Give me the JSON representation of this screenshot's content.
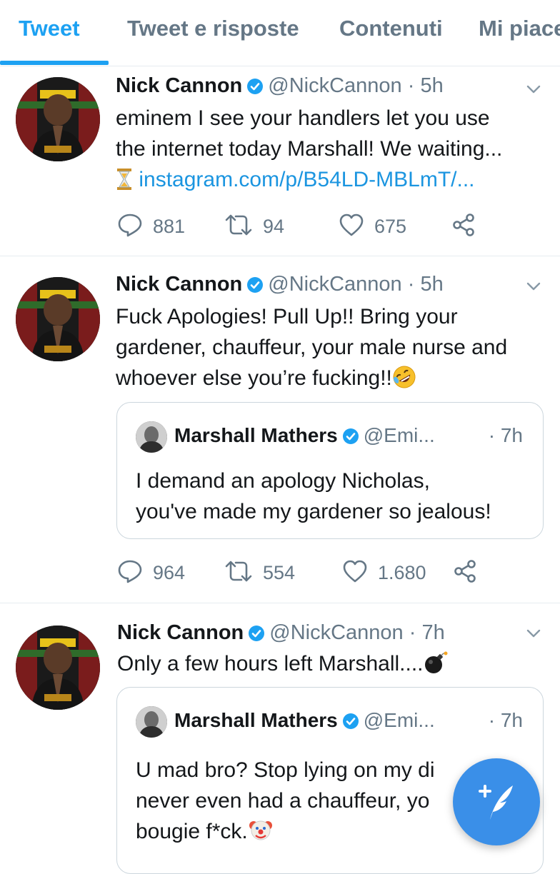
{
  "tabs": [
    {
      "label": "Tweet",
      "active": true
    },
    {
      "label": "Tweet e risposte",
      "active": false
    },
    {
      "label": "Contenuti",
      "active": false
    },
    {
      "label": "Mi piace",
      "active": false
    }
  ],
  "tweets": [
    {
      "name": "Nick Cannon",
      "handle": "@NickCannon",
      "time": "· 5h",
      "text_lines": [
        "eminem I see your handlers let you use",
        "the internet today Marshall! We waiting..."
      ],
      "link": "instagram.com/p/B54LD-MBLmT/...",
      "emoji": "hourglass",
      "replies": "881",
      "retweets": "94",
      "likes": "675"
    },
    {
      "name": "Nick Cannon",
      "handle": "@NickCannon",
      "time": "· 5h",
      "text_lines": [
        "Fuck Apologies! Pull Up!! Bring your",
        "gardener, chauffeur, your male nurse and",
        "whoever else you’re fucking!!"
      ],
      "emoji": "rolling-on-floor-laughing",
      "quote": {
        "name": "Marshall Mathers",
        "handle": "@Emi...",
        "time": "· 7h",
        "text_lines": [
          "I demand an apology Nicholas,",
          "you've made my gardener so jealous!"
        ]
      },
      "replies": "964",
      "retweets": "554",
      "likes": "1.680"
    },
    {
      "name": "Nick Cannon",
      "handle": "@NickCannon",
      "time": "· 7h",
      "text_lines": [
        "Only a few hours left Marshall...."
      ],
      "emoji": "bomb",
      "quote": {
        "name": "Marshall Mathers",
        "handle": "@Emi...",
        "time": "· 7h",
        "text_lines": [
          "U mad bro?  Stop lying on my di",
          "never even had a chauffeur, yo",
          "bougie f*ck."
        ],
        "emoji": "clown-face"
      }
    }
  ],
  "compose_icon": "compose-tweet-icon",
  "colors": {
    "accent": "#1da1f2",
    "link": "#1b95e0",
    "secondary_text": "#657786",
    "divider": "#e6ecf0",
    "fab": "#3a8fe8"
  }
}
